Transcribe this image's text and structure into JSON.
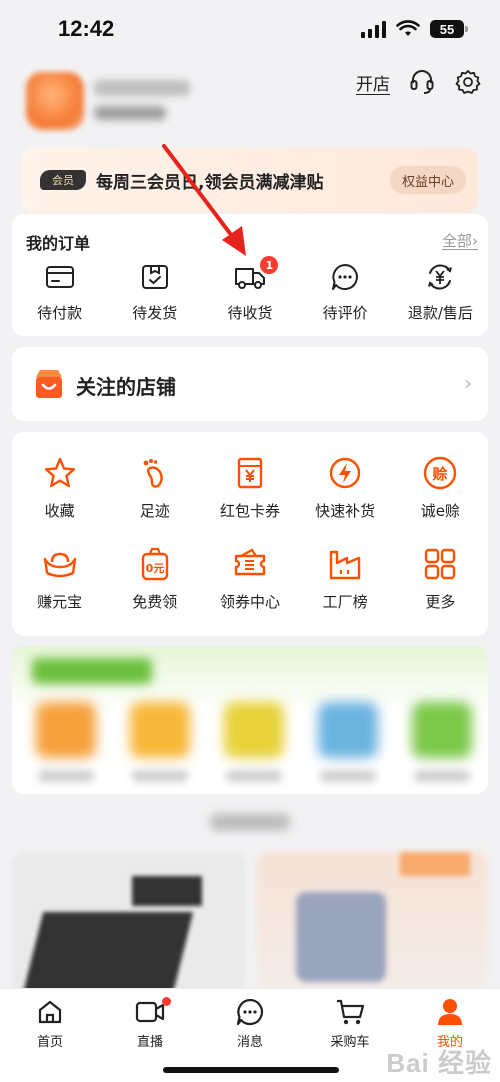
{
  "status_bar": {
    "time": "12:42",
    "battery": "55"
  },
  "header": {
    "open_shop": "开店"
  },
  "member_banner": {
    "badge": "会员",
    "text": "每周三会员日,领会员满减津贴",
    "button": "权益中心"
  },
  "orders": {
    "title": "我的订单",
    "all_link": "全部",
    "items": [
      {
        "label": "待付款",
        "icon": "wallet-card-icon"
      },
      {
        "label": "待发货",
        "icon": "package-box-icon"
      },
      {
        "label": "待收货",
        "icon": "delivery-truck-icon",
        "badge": "1"
      },
      {
        "label": "待评价",
        "icon": "comment-bubble-icon"
      },
      {
        "label": "退款/售后",
        "icon": "refund-yen-icon"
      }
    ]
  },
  "followed_shops": {
    "title": "关注的店铺",
    "icon": "shop-bag-icon"
  },
  "tools": [
    {
      "label": "收藏",
      "icon": "star-icon"
    },
    {
      "label": "足迹",
      "icon": "footprint-icon"
    },
    {
      "label": "红包卡券",
      "icon": "red-envelope-icon"
    },
    {
      "label": "快速补货",
      "icon": "lightning-icon"
    },
    {
      "label": "诚e赊",
      "icon": "credit-seal-icon"
    },
    {
      "label": "赚元宝",
      "icon": "gold-ingot-icon"
    },
    {
      "label": "免费领",
      "icon": "free-bag-icon"
    },
    {
      "label": "领券中心",
      "icon": "coupon-icon"
    },
    {
      "label": "工厂榜",
      "icon": "factory-icon"
    },
    {
      "label": "更多",
      "icon": "grid-more-icon"
    }
  ],
  "tabbar": [
    {
      "label": "首页",
      "icon": "home-icon"
    },
    {
      "label": "直播",
      "icon": "live-camera-icon"
    },
    {
      "label": "消息",
      "icon": "message-icon"
    },
    {
      "label": "采购车",
      "icon": "cart-icon"
    },
    {
      "label": "我的",
      "icon": "profile-icon"
    }
  ],
  "watermark": "Bai 经验",
  "colors": {
    "accent": "#ff5000",
    "badge_red": "#ff3b30",
    "annotation_arrow": "#e8231c"
  }
}
